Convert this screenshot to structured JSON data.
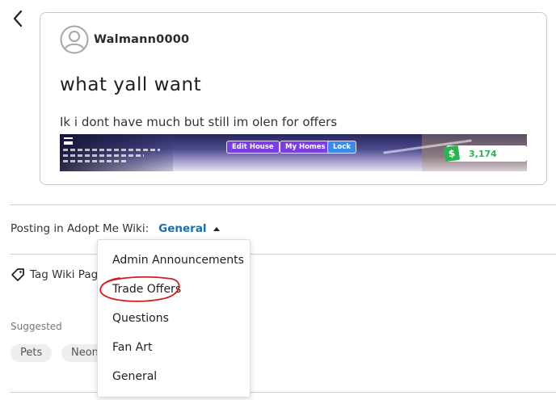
{
  "post": {
    "author": "Walmann0000",
    "title": "what yall want",
    "body": "Ik i dont have much but still im olen for offers",
    "screenshot": {
      "buttons": [
        "Edit House",
        "My Homes",
        "Lock"
      ],
      "money": "3,174"
    }
  },
  "posting": {
    "label": "Posting in Adopt Me Wiki:",
    "current": "General"
  },
  "tag": {
    "label": "Tag Wiki Page"
  },
  "suggested": {
    "label": "Suggested",
    "chips": [
      "Pets",
      "Neon"
    ]
  },
  "dropdown": {
    "options": [
      "Admin Announcements",
      "Trade Offers",
      "Questions",
      "Fan Art",
      "General"
    ],
    "circled": "Trade Offers"
  },
  "colors": {
    "accent": "#1a6fa8",
    "annotation": "#d21e1e",
    "game_button": "#7a3fe0",
    "game_lock": "#3b8ae6",
    "money": "#2bb352"
  },
  "icons": {
    "back": "chevron-left-icon",
    "avatar": "user-avatar-icon",
    "tag": "tag-icon",
    "caret": "caret-up-icon"
  }
}
